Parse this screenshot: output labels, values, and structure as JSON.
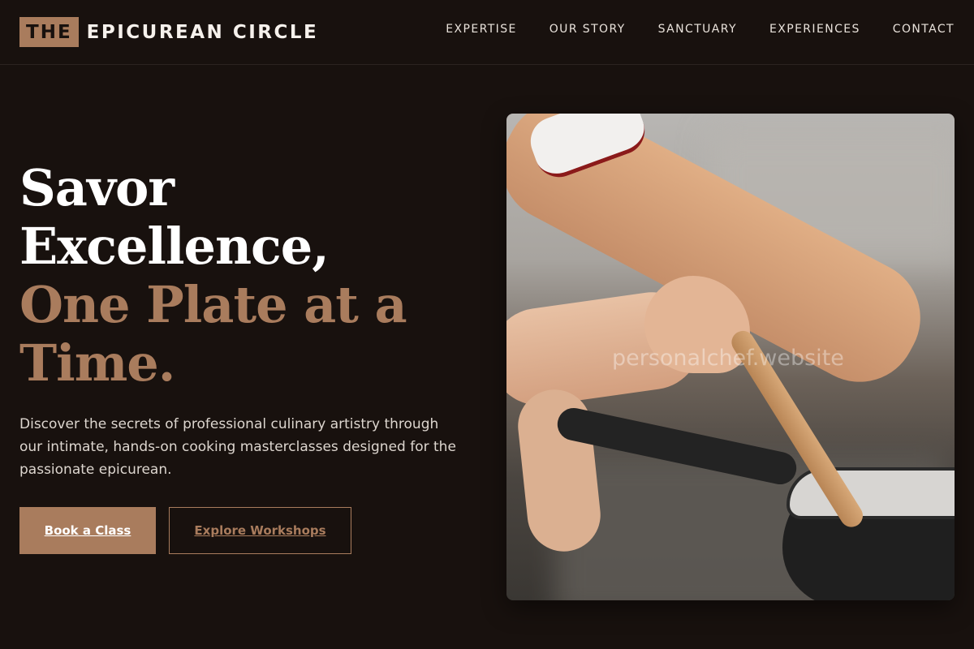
{
  "brand": {
    "prefix": "THE",
    "name": "EPICUREAN CIRCLE"
  },
  "nav": {
    "items": [
      {
        "label": "EXPERTISE"
      },
      {
        "label": "OUR STORY"
      },
      {
        "label": "SANCTUARY"
      },
      {
        "label": "EXPERIENCES"
      },
      {
        "label": "CONTACT"
      }
    ]
  },
  "hero": {
    "headline_line1": "Savor",
    "headline_line2": "Excellence,",
    "headline_line3": "One Plate at a",
    "headline_line4": "Time.",
    "subtitle": "Discover the secrets of professional culinary artistry through our intimate, hands-on cooking masterclasses designed for the passionate epicurean.",
    "primary_cta": "Book a Class",
    "secondary_cta": "Explore Workshops",
    "image_watermark": "personalchef.website"
  },
  "colors": {
    "background": "#18110e",
    "accent": "#a97c5d",
    "text": "#ffffff"
  }
}
